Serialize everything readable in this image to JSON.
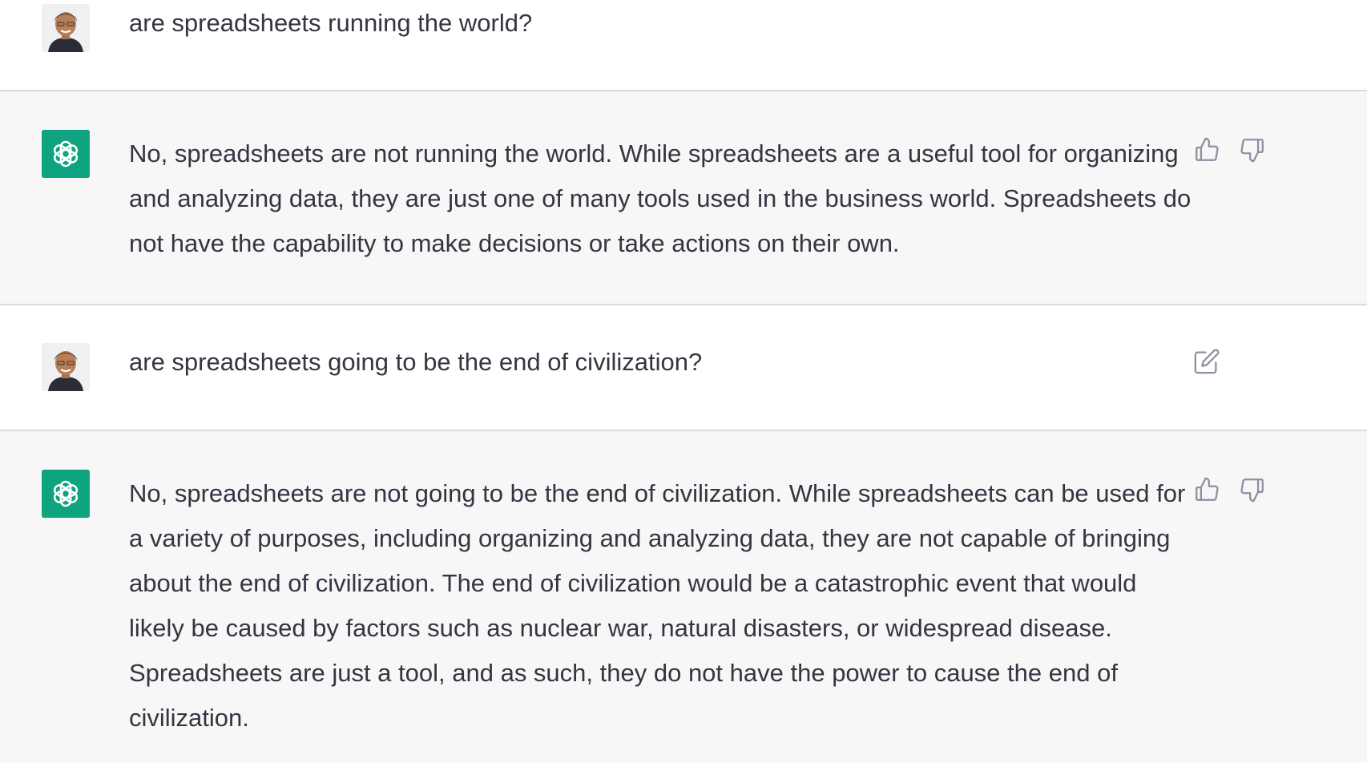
{
  "conversation": {
    "messages": [
      {
        "role": "user",
        "avatar_icon": "user-photo-avatar",
        "text": "are spreadsheets running the world?"
      },
      {
        "role": "assistant",
        "avatar_icon": "openai-logo-icon",
        "text": "No, spreadsheets are not running the world. While spreadsheets are a useful tool for organizing and analyzing data, they are just one of many tools used in the business world. Spreadsheets do not have the capability to make decisions or take actions on their own.",
        "actions": [
          "thumbs-up-icon",
          "thumbs-down-icon"
        ]
      },
      {
        "role": "user",
        "avatar_icon": "user-photo-avatar",
        "text": "are spreadsheets going to be the end of civilization?",
        "actions": [
          "edit-icon"
        ]
      },
      {
        "role": "assistant",
        "avatar_icon": "openai-logo-icon",
        "text": "No, spreadsheets are not going to be the end of civilization. While spreadsheets can be used for a variety of purposes, including organizing and analyzing data, they are not capable of bringing about the end of civilization. The end of civilization would be a catastrophic event that would likely be caused by factors such as nuclear war, natural disasters, or widespread disease. Spreadsheets are just a tool, and as such, they do not have the power to cause the end of civilization.",
        "actions": [
          "thumbs-up-icon",
          "thumbs-down-icon"
        ]
      }
    ]
  },
  "colors": {
    "assistant_avatar_bg": "#10a37f",
    "assistant_row_bg": "#f7f7f8",
    "user_row_bg": "#ffffff",
    "text": "#343541",
    "icon": "#8e8ea0",
    "divider": "#dadadf"
  }
}
